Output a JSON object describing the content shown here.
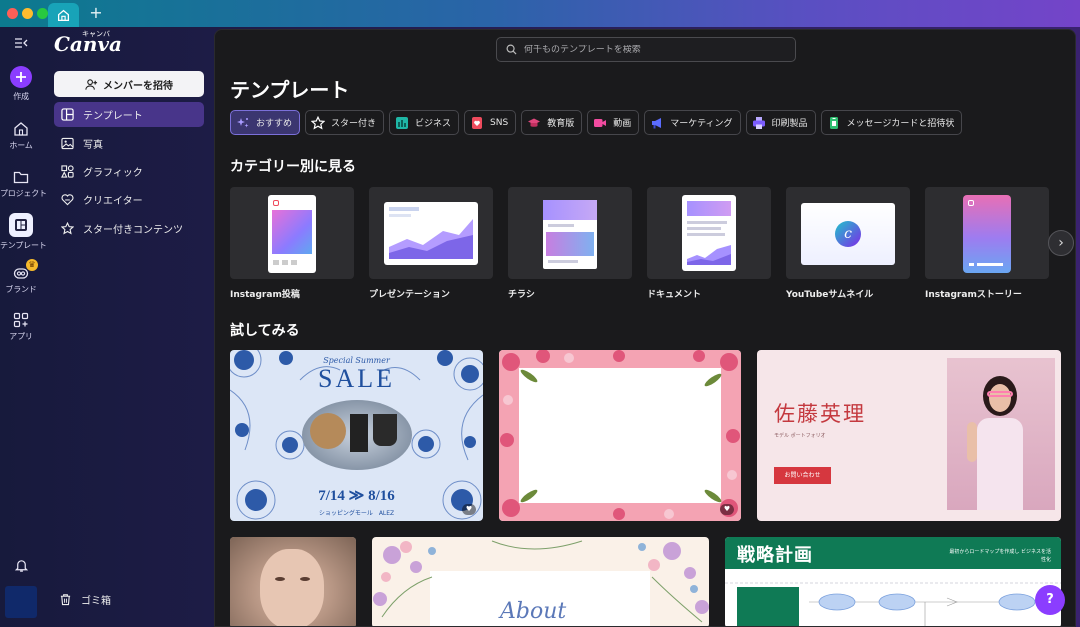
{
  "window": {
    "new_tab_label": "+"
  },
  "rail": {
    "create": "作成",
    "home": "ホーム",
    "projects": "プロジェクト",
    "templates": "テンプレート",
    "brand": "ブランド",
    "apps": "アプリ"
  },
  "panel": {
    "logo": "Canva",
    "logo_kana": "キャンバ",
    "invite_button": "メンバーを招待",
    "nav": [
      {
        "label": "テンプレート",
        "icon": "template-icon",
        "active": true
      },
      {
        "label": "写真",
        "icon": "photo-icon",
        "active": false
      },
      {
        "label": "グラフィック",
        "icon": "graphics-icon",
        "active": false
      },
      {
        "label": "クリエイター",
        "icon": "creator-heart-icon",
        "active": false
      },
      {
        "label": "スター付きコンテンツ",
        "icon": "star-icon",
        "active": false
      }
    ],
    "trash": "ゴミ箱"
  },
  "main": {
    "search_placeholder": "何千ものテンプレートを検索",
    "title": "テンプレート",
    "chips": [
      {
        "label": "おすすめ",
        "active": true,
        "color": "#8b7bff"
      },
      {
        "label": "スター付き",
        "active": false,
        "color": "#ffffff"
      },
      {
        "label": "ビジネス",
        "active": false,
        "color": "#1fb7a6"
      },
      {
        "label": "SNS",
        "active": false,
        "color": "#ef4b5d"
      },
      {
        "label": "教育版",
        "active": false,
        "color": "#e0467c"
      },
      {
        "label": "動画",
        "active": false,
        "color": "#f24ba0"
      },
      {
        "label": "マーケティング",
        "active": false,
        "color": "#5b6cff"
      },
      {
        "label": "印刷製品",
        "active": false,
        "color": "#7b5cff"
      },
      {
        "label": "メッセージカードと招待状",
        "active": false,
        "color": "#2fbf71"
      }
    ],
    "category_title": "カテゴリー別に見る",
    "categories": [
      {
        "label": "Instagram投稿"
      },
      {
        "label": "プレゼンテーション"
      },
      {
        "label": "チラシ"
      },
      {
        "label": "ドキュメント"
      },
      {
        "label": "YouTubeサムネイル"
      },
      {
        "label": "Instagramストーリー"
      }
    ],
    "try_title": "試してみる",
    "cards": {
      "sale": {
        "script": "Special Summer",
        "title": "SALE",
        "dates": "7/14 ≫ 8/16",
        "footer": "ショッピングモール　ALEZ"
      },
      "portfolio": {
        "name": "佐藤英理",
        "sub": "モデル ポートフォリオ",
        "button": "お問い合わせ"
      },
      "strategy": {
        "title": "戦略計画",
        "note": "最初からロードマップを作成し ビジネスを活性化"
      },
      "floral2": {
        "script": "About"
      }
    },
    "help": "?"
  }
}
